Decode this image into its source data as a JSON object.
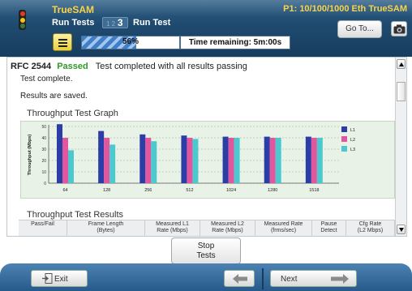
{
  "header": {
    "app_title": "TrueSAM",
    "port_info": "P1: 10/100/1000 Eth TrueSAM",
    "nav_run_tests": "Run Tests",
    "steps": {
      "dim": "1 2",
      "current": "3"
    },
    "nav_run_test": "Run Test",
    "goto_label": "Go To...",
    "progress_percent": 56,
    "progress_label": "56%",
    "time_remaining": "Time remaining: 5m:00s"
  },
  "content": {
    "rfc": "RFC 2544",
    "status": "Passed",
    "status_color": "#2d9a2a",
    "message": "Test completed with all results passing",
    "line1": "Test complete.",
    "line2": "Results are saved.",
    "graph_title": "Throughput Test Graph",
    "results_title": "Throughput Test Results",
    "table_headers": [
      "Pass/Fail",
      "Frame Length\n(Bytes)",
      "Measured L1\nRate (Mbps)",
      "Measured L2\nRate (Mbps)",
      "Measured Rate\n(frms/sec)",
      "Pause\nDetect",
      "Cfg Rate\n(L2 Mbps)"
    ]
  },
  "chart_data": {
    "type": "bar",
    "ylabel": "Throughput (Mbps)",
    "ylim": [
      0,
      50
    ],
    "yticks": [
      0,
      10,
      20,
      30,
      40,
      50
    ],
    "categories": [
      "64",
      "128",
      "256",
      "512",
      "1024",
      "1280",
      "1518"
    ],
    "series": [
      {
        "name": "L1",
        "color": "#2b3ea6",
        "values": [
          52,
          46,
          43,
          42,
          41,
          41,
          41
        ]
      },
      {
        "name": "L2",
        "color": "#e2559f",
        "values": [
          40,
          40,
          40,
          40,
          40,
          40,
          40
        ]
      },
      {
        "name": "L3",
        "color": "#4cc9cf",
        "values": [
          29,
          34,
          37,
          39,
          40,
          40,
          40
        ]
      }
    ],
    "legend": "right",
    "grid": true
  },
  "buttons": {
    "stop_line1": "Stop",
    "stop_line2": "Tests",
    "exit": "Exit",
    "next": "Next"
  }
}
